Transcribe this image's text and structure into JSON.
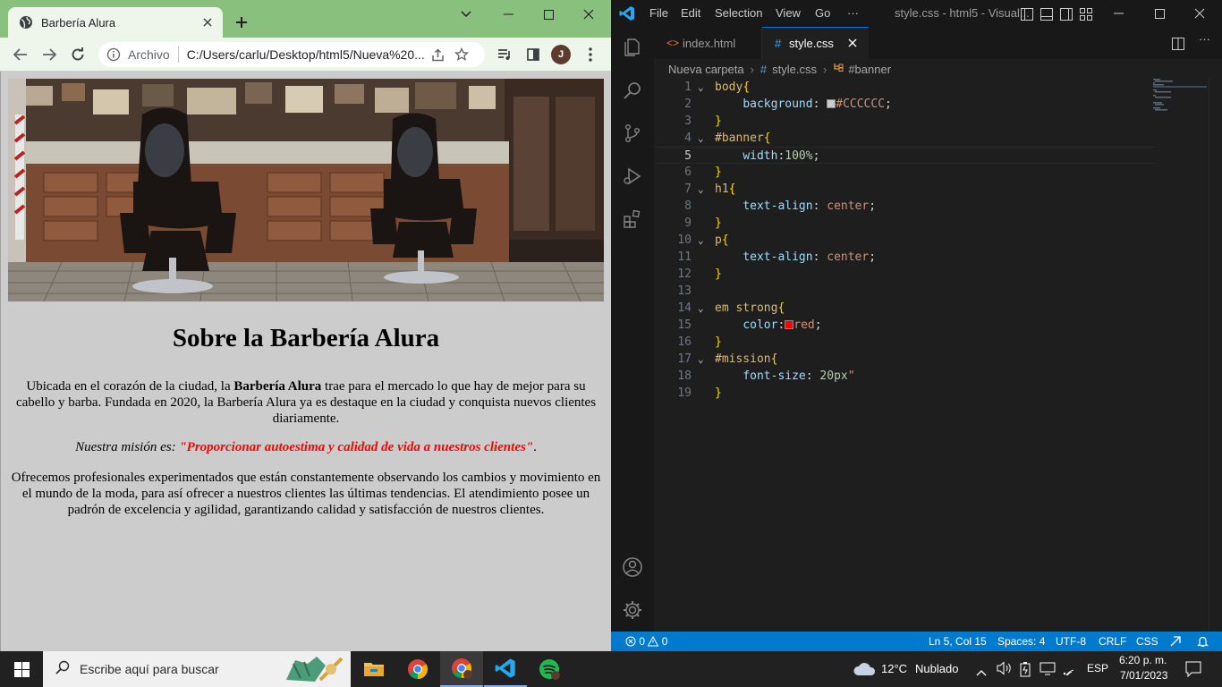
{
  "browser": {
    "tab_title": "Barbería Alura",
    "scheme_label": "Archivo",
    "url": "C:/Users/carlu/Desktop/html5/Nueva%20...",
    "avatar_initial": "J"
  },
  "page": {
    "heading": "Sobre la Barbería Alura",
    "p1_before": "Ubicada en el corazón de la ciudad, la ",
    "p1_bold": "Barbería Alura",
    "p1_after": " trae para el mercado lo que hay de mejor para su cabello y barba. Fundada en 2020, la Barbería Alura ya es destaque en la ciudad y conquista nuevos clientes diariamente.",
    "mission_label": "Nuestra misión es:",
    "mission_text": "\"Proporcionar autoestima y calidad de vida a nuestros clientes\"",
    "mission_end": ".",
    "p3": "Ofrecemos profesionales experimentados que están constantemente observando los cambios y movimiento en el mundo de la moda, para así ofrecer a nuestros clientes las últimas tendencias. El atendimiento posee un padrón de excelencia y agilidad, garantizando calidad y satisfacción de nuestros clientes."
  },
  "vscode": {
    "menu": [
      "File",
      "Edit",
      "Selection",
      "View",
      "Go",
      "···"
    ],
    "window_title": "style.css - html5 - Visual...",
    "tabs": [
      {
        "label": "index.html",
        "active": false
      },
      {
        "label": "style.css",
        "active": true
      }
    ],
    "breadcrumb": [
      "Nueva carpeta",
      "style.css",
      "#banner"
    ],
    "code_lines": [
      {
        "n": "1",
        "fold": true,
        "html": "<span style='color:#d7ba7d'>body</span><span style='color:#ffd700'>{</span>"
      },
      {
        "n": "2",
        "fold": false,
        "html": "    <span style='color:#9cdcfe'>background</span><span style='color:#d4d4d4'>: </span><span style='display:inline-block;width:10px;height:10px;background:#cccccc;border:1px solid #888;vertical-align:-1px'></span><span style='color:#ce9178'>#CCCCCC</span><span style='color:#d4d4d4'>;</span>"
      },
      {
        "n": "3",
        "fold": false,
        "html": "<span style='color:#ffd700'>}</span>"
      },
      {
        "n": "4",
        "fold": true,
        "html": "<span style='color:#d7ba7d'>#banner</span><span style='color:#ffd700'>{</span>"
      },
      {
        "n": "5",
        "fold": false,
        "html": "    <span style='color:#9cdcfe'>width</span><span style='color:#d4d4d4'>:</span><span style='color:#b5cea8'>100%</span><span style='color:#d4d4d4'>;</span>"
      },
      {
        "n": "6",
        "fold": false,
        "html": "<span style='color:#ffd700'>}</span>"
      },
      {
        "n": "7",
        "fold": true,
        "html": "<span style='color:#d7ba7d'>h1</span><span style='color:#ffd700'>{</span>"
      },
      {
        "n": "8",
        "fold": false,
        "html": "    <span style='color:#9cdcfe'>text-align</span><span style='color:#d4d4d4'>: </span><span style='color:#ce9178'>center</span><span style='color:#d4d4d4'>;</span>"
      },
      {
        "n": "9",
        "fold": false,
        "html": "<span style='color:#ffd700'>}</span>"
      },
      {
        "n": "10",
        "fold": true,
        "html": "<span style='color:#d7ba7d'>p</span><span style='color:#ffd700'>{</span>"
      },
      {
        "n": "11",
        "fold": false,
        "html": "    <span style='color:#9cdcfe'>text-align</span><span style='color:#d4d4d4'>: </span><span style='color:#ce9178'>center</span><span style='color:#d4d4d4'>;</span>"
      },
      {
        "n": "12",
        "fold": false,
        "html": "<span style='color:#ffd700'>}</span>"
      },
      {
        "n": "13",
        "fold": false,
        "html": ""
      },
      {
        "n": "14",
        "fold": true,
        "html": "<span style='color:#d7ba7d'>em strong</span><span style='color:#ffd700'>{</span>"
      },
      {
        "n": "15",
        "fold": false,
        "html": "    <span style='color:#9cdcfe'>color</span><span style='color:#d4d4d4'>:</span><span style='display:inline-block;width:10px;height:10px;background:#ff0000;border:1px solid #888;vertical-align:-1px'></span><span style='color:#ce9178'>red</span><span style='color:#d4d4d4'>;</span>"
      },
      {
        "n": "16",
        "fold": false,
        "html": "<span style='color:#ffd700'>}</span>"
      },
      {
        "n": "17",
        "fold": true,
        "html": "<span style='color:#d7ba7d'>#mission</span><span style='color:#ffd700'>{</span>"
      },
      {
        "n": "18",
        "fold": false,
        "html": "    <span style='color:#9cdcfe'>font-size</span><span style='color:#d4d4d4'>: </span><span style='color:#b5cea8'>20px</span><span style='color:#ce9178'>\"</span>"
      },
      {
        "n": "19",
        "fold": false,
        "html": "<span style='color:#ffd700'>}</span>"
      }
    ],
    "current_line": 5,
    "status": {
      "errors": "0",
      "warnings": "0",
      "position": "Ln 5, Col 15",
      "spaces": "Spaces: 4",
      "encoding": "UTF-8",
      "eol": "CRLF",
      "language": "CSS"
    }
  },
  "taskbar": {
    "search_placeholder": "Escribe aquí para buscar",
    "weather_temp": "12°C",
    "weather_desc": "Nublado",
    "lang": "ESP",
    "time": "6:20 p. m.",
    "date": "7/01/2023"
  },
  "colors": {
    "chrome_frame": "#8ac07e",
    "page_bg": "#cccccc",
    "mission_red": "#ff0000",
    "vscode_status": "#007acc"
  }
}
